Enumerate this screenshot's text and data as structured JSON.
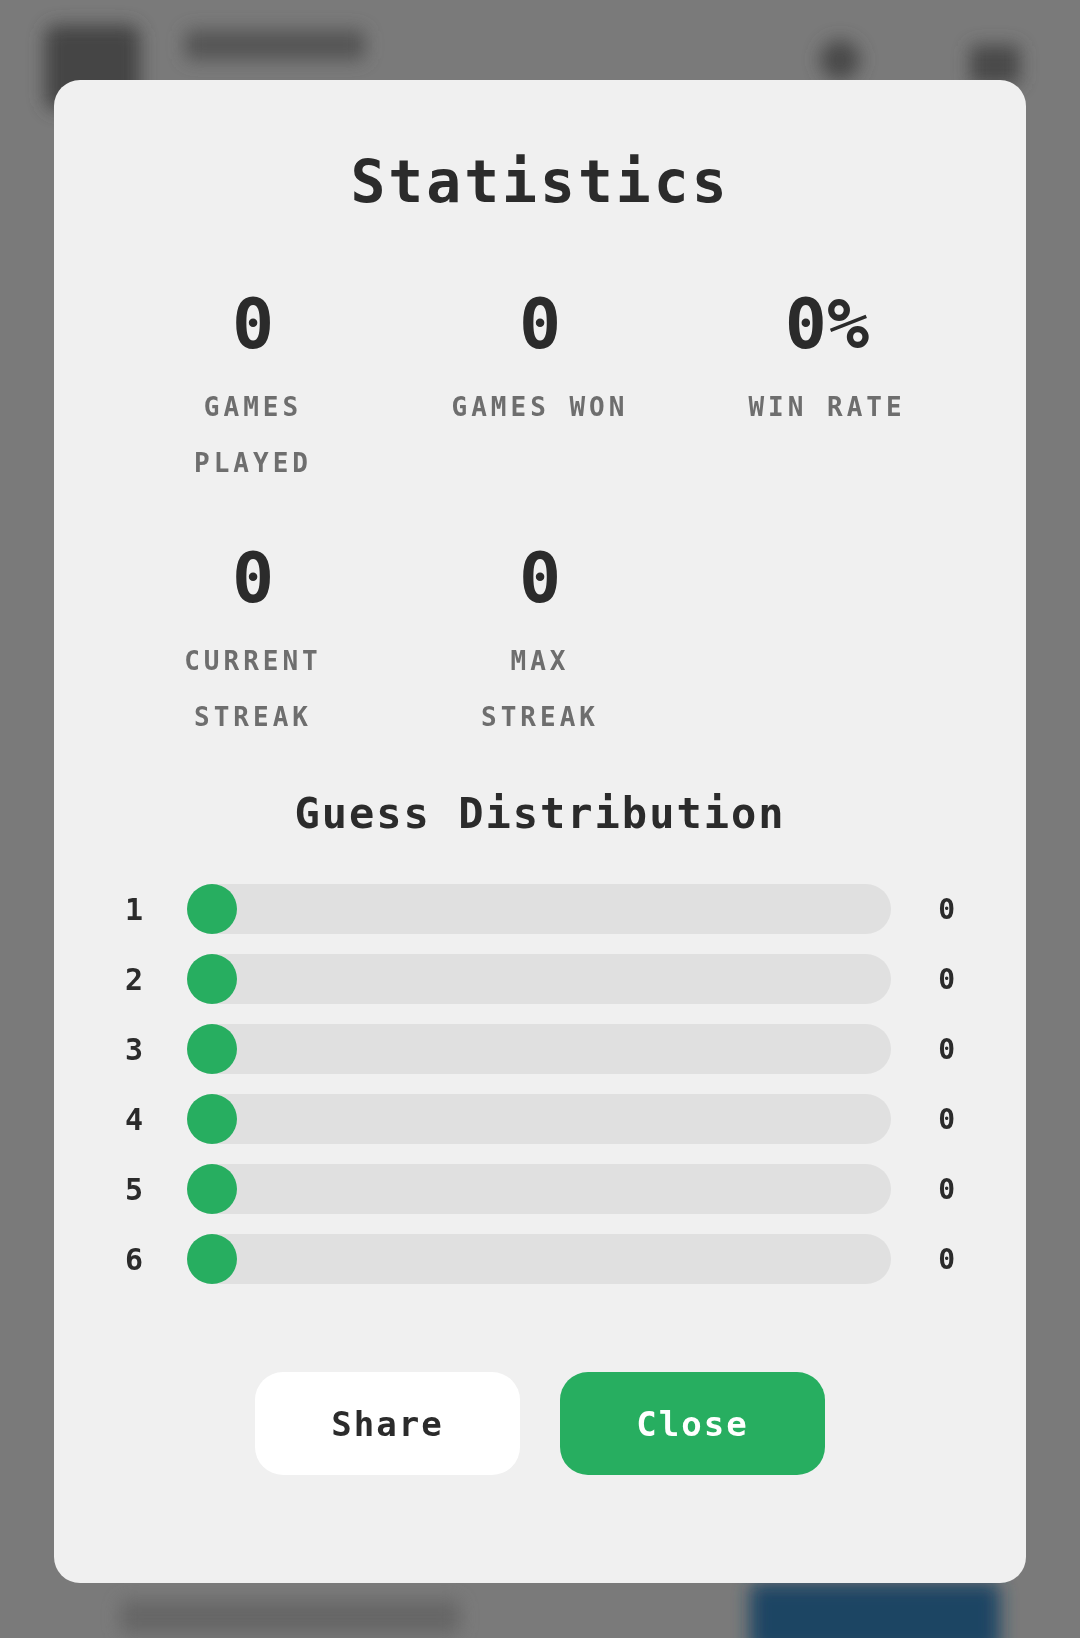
{
  "dialog": {
    "title": "Statistics",
    "stats": [
      {
        "value": "0",
        "label": "GAMES PLAYED"
      },
      {
        "value": "0",
        "label": "GAMES WON"
      },
      {
        "value": "0%",
        "label": "WIN RATE"
      },
      {
        "value": "0",
        "label": "CURRENT STREAK"
      },
      {
        "value": "0",
        "label": "MAX STREAK"
      }
    ],
    "distribution": {
      "title": "Guess Distribution",
      "rows": [
        {
          "guess": "1",
          "level": 0,
          "count": "0"
        },
        {
          "guess": "2",
          "level": 0,
          "count": "0"
        },
        {
          "guess": "3",
          "level": 0,
          "count": "0"
        },
        {
          "guess": "4",
          "level": 0,
          "count": "0"
        },
        {
          "guess": "5",
          "level": 0,
          "count": "0"
        },
        {
          "guess": "6",
          "level": 0,
          "count": "0"
        }
      ]
    },
    "buttons": [
      {
        "label": "Share",
        "kind": "secondary"
      },
      {
        "label": "Close",
        "kind": "primary"
      }
    ]
  }
}
